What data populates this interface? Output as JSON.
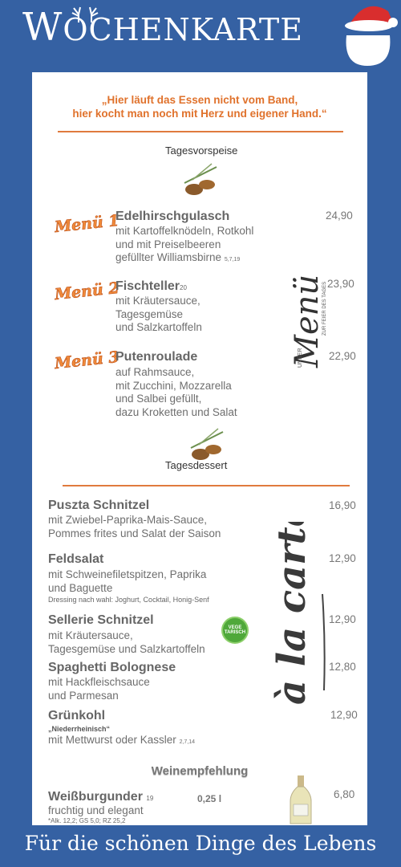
{
  "header": {
    "title_first": "W",
    "title_rest": "OCHENKARTE"
  },
  "quote": {
    "line1": "„Hier läuft das Essen nicht vom Band,",
    "line2": "hier kocht man noch mit Herz und eigener Hand.“"
  },
  "sections": {
    "starter": "Tagesvorspeise",
    "dessert": "Tagesdessert"
  },
  "menus": [
    {
      "tag": "Menü 1",
      "title": "Edelhirschgulasch",
      "title_sup": "",
      "lines": [
        "mit Kartoffelknödeln, Rotkohl",
        "und mit Preiselbeeren"
      ],
      "last_line": "gefüllter Williamsbirne",
      "last_sup": "5,7,19",
      "price": "24,90"
    },
    {
      "tag": "Menü 2",
      "title": "Fischteller",
      "title_sup": "20",
      "lines": [
        "mit Kräutersauce,",
        "Tagesgemüse"
      ],
      "last_line": "und Salzkartoffeln",
      "last_sup": "",
      "price": "23,90"
    },
    {
      "tag": "Menü 3",
      "title": "Putenroulade",
      "title_sup": "",
      "lines": [
        "auf Rahmsauce,",
        "mit Zucchini, Mozzarella",
        "und Salbei gefüllt,"
      ],
      "last_line": "dazu Kroketten und Salat",
      "last_sup": "",
      "price": "22,90"
    }
  ],
  "menu_script": {
    "unser": "UNSER",
    "word": "Menü",
    "sub": "ZUR FEIER DES TAGES"
  },
  "carte": {
    "word": "à la carte"
  },
  "dishes": [
    {
      "title": "Puszta Schnitzel",
      "lines": [
        "mit Zwiebel-Paprika-Mais-Sauce,",
        "Pommes frites und Salat der Saison"
      ],
      "price": "16,90"
    },
    {
      "title": "Feldsalat",
      "lines": [
        "mit Schweinefiletspitzen, Paprika",
        "und Baguette"
      ],
      "note": "Dressing nach wahl: Joghurt, Cocktail, Honig-Senf",
      "price": "12,90"
    },
    {
      "title": "Sellerie Schnitzel",
      "lines": [
        "mit Kräutersauce,",
        "Tagesgemüse und Salzkartoffeln"
      ],
      "price": "12,90"
    },
    {
      "title": "Spaghetti Bolognese",
      "lines": [
        "mit Hackfleischsauce",
        "und Parmesan"
      ],
      "price": "12,80"
    },
    {
      "title": "Grünkohl",
      "bold_note": "„Niederrheinisch“",
      "last_line": "mit Mettwurst oder Kassler",
      "last_sup": "2,7,14",
      "price": "12,90"
    }
  ],
  "badge": {
    "text": "VEGE TARISCH"
  },
  "wine": {
    "heading": "Weinempfehlung",
    "name": "Weißburgunder",
    "name_sup": "19",
    "amount": "0,25 l",
    "desc": "fruchtig und elegant",
    "note": "*Alk. 12,2; GS 5,0; RZ 25,2",
    "price": "6,80"
  },
  "footer": {
    "text": "Für die schönen Dinge des Lebens"
  }
}
